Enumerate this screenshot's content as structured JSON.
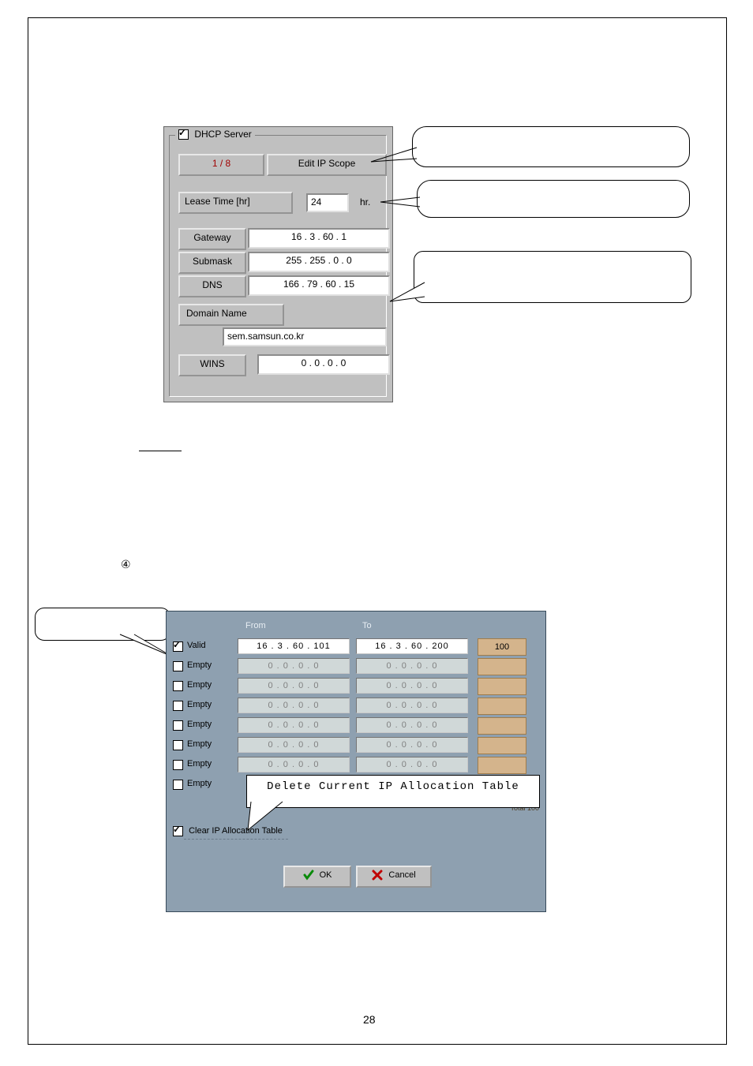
{
  "page_number": "28",
  "step_marker": "④",
  "dhcp": {
    "title": "DHCP Server",
    "title_checked": true,
    "counter": "1 / 8",
    "edit_button": "Edit IP Scope",
    "lease_label": "Lease Time [hr]",
    "lease_value": "24",
    "lease_unit": "hr.",
    "gateway_label": "Gateway",
    "gateway_value": "16 . 3 . 60 . 1",
    "submask_label": "Submask",
    "submask_value": "255 . 255 . 0 . 0",
    "dns_label": "DNS",
    "dns_value": "166 . 79 . 60 . 15",
    "domain_button": "Domain Name",
    "domain_value": "sem.samsun.co.kr",
    "wins_label": "WINS",
    "wins_value": "0 . 0 . 0 . 0"
  },
  "scope": {
    "col_from": "From",
    "col_to": "To",
    "rows": [
      {
        "valid": true,
        "label": "Valid",
        "from": "16 . 3 . 60 . 101",
        "to": "16 . 3 . 60 . 200",
        "count": "100"
      },
      {
        "valid": false,
        "label": "Empty",
        "from": "0 . 0 . 0 . 0",
        "to": "0 . 0 . 0 . 0",
        "count": ""
      },
      {
        "valid": false,
        "label": "Empty",
        "from": "0 . 0 . 0 . 0",
        "to": "0 . 0 . 0 . 0",
        "count": ""
      },
      {
        "valid": false,
        "label": "Empty",
        "from": "0 . 0 . 0 . 0",
        "to": "0 . 0 . 0 . 0",
        "count": ""
      },
      {
        "valid": false,
        "label": "Empty",
        "from": "0 . 0 . 0 . 0",
        "to": "0 . 0 . 0 . 0",
        "count": ""
      },
      {
        "valid": false,
        "label": "Empty",
        "from": "0 . 0 . 0 . 0",
        "to": "0 . 0 . 0 . 0",
        "count": ""
      },
      {
        "valid": false,
        "label": "Empty",
        "from": "0 . 0 . 0 . 0",
        "to": "0 . 0 . 0 . 0",
        "count": ""
      },
      {
        "valid": false,
        "label": "Empty",
        "from": "",
        "to": "",
        "count": ""
      }
    ],
    "total_label": "Total 100",
    "clear_label": "Clear IP Allocation Table",
    "clear_checked": true,
    "ok_label": "OK",
    "cancel_label": "Cancel",
    "overlay_text": "Delete Current IP Allocation Table"
  }
}
